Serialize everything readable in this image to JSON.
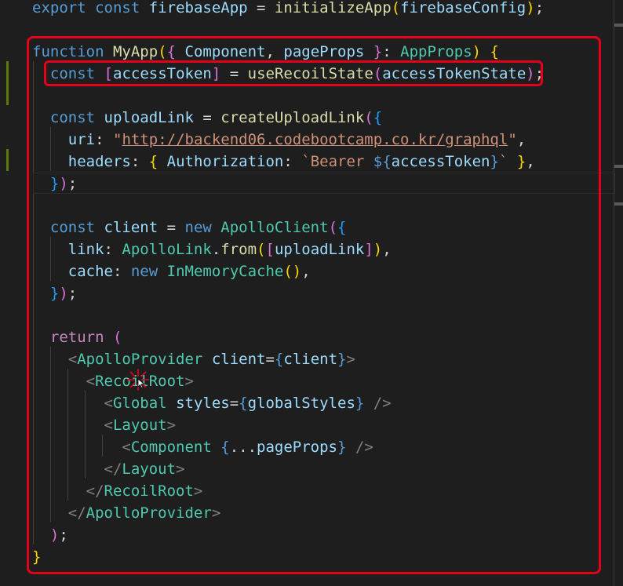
{
  "code_lines": [
    {
      "tokens": [
        [
          "kw",
          "export"
        ],
        [
          "pun",
          " "
        ],
        [
          "kw",
          "const"
        ],
        [
          "pun",
          " "
        ],
        [
          "var",
          "firebaseApp"
        ],
        [
          "pun",
          " = "
        ],
        [
          "fn",
          "initializeApp"
        ],
        [
          "br1",
          "("
        ],
        [
          "var",
          "firebaseConfig"
        ],
        [
          "br1",
          ")"
        ],
        [
          "pun",
          ";"
        ]
      ]
    },
    {
      "tokens": []
    },
    {
      "tokens": [
        [
          "kw",
          "function"
        ],
        [
          "pun",
          " "
        ],
        [
          "fn",
          "MyApp"
        ],
        [
          "br1",
          "("
        ],
        [
          "br2",
          "{"
        ],
        [
          "pun",
          " "
        ],
        [
          "var",
          "Component"
        ],
        [
          "pun",
          ", "
        ],
        [
          "var",
          "pageProps"
        ],
        [
          "pun",
          " "
        ],
        [
          "br2",
          "}"
        ],
        [
          "pun",
          ": "
        ],
        [
          "type",
          "AppProps"
        ],
        [
          "br1",
          ")"
        ],
        [
          "pun",
          " "
        ],
        [
          "br1",
          "{"
        ]
      ]
    },
    {
      "tokens": [
        [
          "pun",
          "  "
        ],
        [
          "kw",
          "const"
        ],
        [
          "pun",
          " "
        ],
        [
          "br2",
          "["
        ],
        [
          "var",
          "accessToken"
        ],
        [
          "br2",
          "]"
        ],
        [
          "pun",
          " = "
        ],
        [
          "fn",
          "useRecoilState"
        ],
        [
          "br2",
          "("
        ],
        [
          "var",
          "accessTokenState"
        ],
        [
          "br2",
          ")"
        ],
        [
          "pun",
          ";"
        ]
      ]
    },
    {
      "tokens": []
    },
    {
      "tokens": [
        [
          "pun",
          "  "
        ],
        [
          "kw",
          "const"
        ],
        [
          "pun",
          " "
        ],
        [
          "var",
          "uploadLink"
        ],
        [
          "pun",
          " = "
        ],
        [
          "fn",
          "createUploadLink"
        ],
        [
          "br2",
          "("
        ],
        [
          "br3",
          "{"
        ]
      ]
    },
    {
      "tokens": [
        [
          "pun",
          "    "
        ],
        [
          "var",
          "uri"
        ],
        [
          "pun",
          ": "
        ],
        [
          "str",
          "\""
        ],
        [
          "url",
          "http://backend06.codebootcamp.co.kr/graphql"
        ],
        [
          "str",
          "\""
        ],
        [
          "pun",
          ","
        ]
      ]
    },
    {
      "tokens": [
        [
          "pun",
          "    "
        ],
        [
          "var",
          "headers"
        ],
        [
          "pun",
          ": "
        ],
        [
          "br1",
          "{"
        ],
        [
          "pun",
          " "
        ],
        [
          "var",
          "Authorization"
        ],
        [
          "pun",
          ": "
        ],
        [
          "str",
          "`Bearer "
        ],
        [
          "tpl",
          "${"
        ],
        [
          "var",
          "accessToken"
        ],
        [
          "tpl",
          "}"
        ],
        [
          "str",
          "`"
        ],
        [
          "pun",
          " "
        ],
        [
          "br1",
          "}"
        ],
        [
          "pun",
          ","
        ]
      ]
    },
    {
      "tokens": [
        [
          "pun",
          "  "
        ],
        [
          "br3",
          "}"
        ],
        [
          "br2",
          ")"
        ],
        [
          "pun",
          ";"
        ]
      ]
    },
    {
      "tokens": []
    },
    {
      "tokens": [
        [
          "pun",
          "  "
        ],
        [
          "kw",
          "const"
        ],
        [
          "pun",
          " "
        ],
        [
          "var",
          "client"
        ],
        [
          "pun",
          " = "
        ],
        [
          "kw",
          "new"
        ],
        [
          "pun",
          " "
        ],
        [
          "type",
          "ApolloClient"
        ],
        [
          "br2",
          "("
        ],
        [
          "br3",
          "{"
        ]
      ]
    },
    {
      "tokens": [
        [
          "pun",
          "    "
        ],
        [
          "var",
          "link"
        ],
        [
          "pun",
          ": "
        ],
        [
          "type",
          "ApolloLink"
        ],
        [
          "pun",
          "."
        ],
        [
          "fn",
          "from"
        ],
        [
          "br1",
          "("
        ],
        [
          "br2",
          "["
        ],
        [
          "var",
          "uploadLink"
        ],
        [
          "br2",
          "]"
        ],
        [
          "br1",
          ")"
        ],
        [
          "pun",
          ","
        ]
      ]
    },
    {
      "tokens": [
        [
          "pun",
          "    "
        ],
        [
          "var",
          "cache"
        ],
        [
          "pun",
          ": "
        ],
        [
          "kw",
          "new"
        ],
        [
          "pun",
          " "
        ],
        [
          "type",
          "InMemoryCache"
        ],
        [
          "br1",
          "()"
        ],
        [
          "pun",
          ","
        ]
      ]
    },
    {
      "tokens": [
        [
          "pun",
          "  "
        ],
        [
          "br3",
          "}"
        ],
        [
          "br2",
          ")"
        ],
        [
          "pun",
          ";"
        ]
      ]
    },
    {
      "tokens": []
    },
    {
      "tokens": [
        [
          "pun",
          "  "
        ],
        [
          "ctl",
          "return"
        ],
        [
          "pun",
          " "
        ],
        [
          "br2",
          "("
        ]
      ]
    },
    {
      "tokens": [
        [
          "pun",
          "    "
        ],
        [
          "tagp",
          "<"
        ],
        [
          "type",
          "ApolloProvider"
        ],
        [
          "pun",
          " "
        ],
        [
          "var",
          "client"
        ],
        [
          "pun",
          "="
        ],
        [
          "kw",
          "{"
        ],
        [
          "var",
          "client"
        ],
        [
          "kw",
          "}"
        ],
        [
          "tagp",
          ">"
        ]
      ]
    },
    {
      "tokens": [
        [
          "pun",
          "      "
        ],
        [
          "tagp",
          "<"
        ],
        [
          "type",
          "RecoilRoot"
        ],
        [
          "tagp",
          ">"
        ]
      ]
    },
    {
      "tokens": [
        [
          "pun",
          "        "
        ],
        [
          "tagp",
          "<"
        ],
        [
          "type",
          "Global"
        ],
        [
          "pun",
          " "
        ],
        [
          "var",
          "styles"
        ],
        [
          "pun",
          "="
        ],
        [
          "kw",
          "{"
        ],
        [
          "var",
          "globalStyles"
        ],
        [
          "kw",
          "}"
        ],
        [
          "pun",
          " "
        ],
        [
          "tagp",
          "/>"
        ]
      ]
    },
    {
      "tokens": [
        [
          "pun",
          "        "
        ],
        [
          "tagp",
          "<"
        ],
        [
          "type",
          "Layout"
        ],
        [
          "tagp",
          ">"
        ]
      ]
    },
    {
      "tokens": [
        [
          "pun",
          "          "
        ],
        [
          "tagp",
          "<"
        ],
        [
          "type",
          "Component"
        ],
        [
          "pun",
          " "
        ],
        [
          "kw",
          "{"
        ],
        [
          "pun",
          "..."
        ],
        [
          "var",
          "pageProps"
        ],
        [
          "kw",
          "}"
        ],
        [
          "pun",
          " "
        ],
        [
          "tagp",
          "/>"
        ]
      ]
    },
    {
      "tokens": [
        [
          "pun",
          "        "
        ],
        [
          "tagp",
          "</"
        ],
        [
          "type",
          "Layout"
        ],
        [
          "tagp",
          ">"
        ]
      ]
    },
    {
      "tokens": [
        [
          "pun",
          "      "
        ],
        [
          "tagp",
          "</"
        ],
        [
          "type",
          "RecoilRoot"
        ],
        [
          "tagp",
          ">"
        ]
      ]
    },
    {
      "tokens": [
        [
          "pun",
          "    "
        ],
        [
          "tagp",
          "</"
        ],
        [
          "type",
          "ApolloProvider"
        ],
        [
          "tagp",
          ">"
        ]
      ]
    },
    {
      "tokens": [
        [
          "pun",
          "  "
        ],
        [
          "br2",
          ")"
        ],
        [
          "pun",
          ";"
        ]
      ]
    },
    {
      "tokens": [
        [
          "br1",
          "}"
        ]
      ]
    }
  ],
  "colors": {
    "background": "#1e1e1e",
    "highlight_box": "#e4001b",
    "keyword": "#569cd6",
    "function": "#dcdcaa",
    "variable": "#9cdcfe",
    "type": "#4ec9b0",
    "string": "#ce9178"
  },
  "icons": {
    "cursor": "mouse-pointer-icon"
  }
}
